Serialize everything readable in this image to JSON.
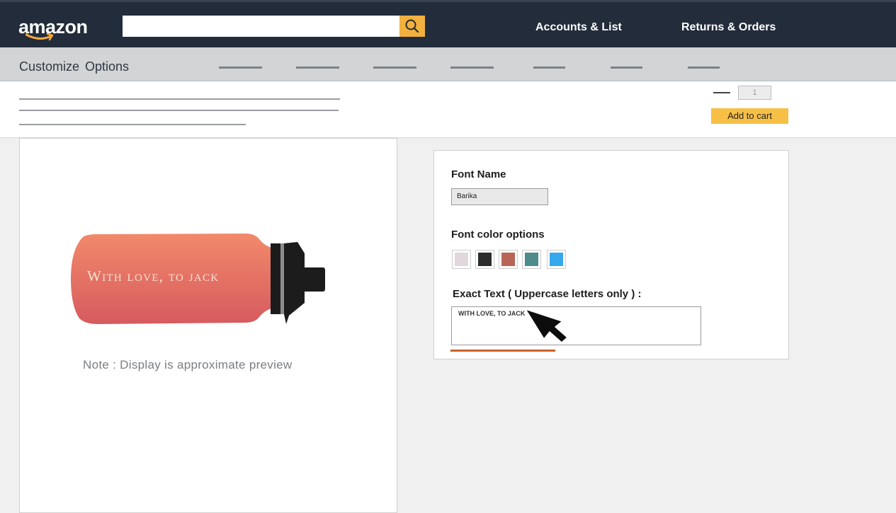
{
  "header": {
    "logo_text": "amazon",
    "search_placeholder": "",
    "nav_links": [
      "Accounts & List",
      "Returns & Orders"
    ]
  },
  "subnav": {
    "title": "Customize  Options"
  },
  "purchase": {
    "quantity": "1",
    "add_to_cart_label": "Add to cart"
  },
  "preview": {
    "bottle_text": "With love, to jack",
    "note": "Note : Display is approximate preview"
  },
  "options": {
    "font_name_label": "Font Name",
    "font_name_value": "Barika",
    "font_color_label": "Font color options",
    "font_colors": [
      "#e1d8dd",
      "#2c2c2c",
      "#b86557",
      "#4e8c8b",
      "#35a8ec"
    ],
    "exact_text_label": "Exact Text ( Uppercase letters only ) :",
    "exact_text_value": "WITH LOVE, TO JACK"
  },
  "colors": {
    "header_bg": "#222c3a",
    "search_button": "#f2b03e",
    "add_to_cart": "#f7bf45",
    "accent_underline": "#c9622a"
  },
  "icons": [
    "search-icon",
    "amazon-smile-logo",
    "cursor-arrow-icon"
  ]
}
